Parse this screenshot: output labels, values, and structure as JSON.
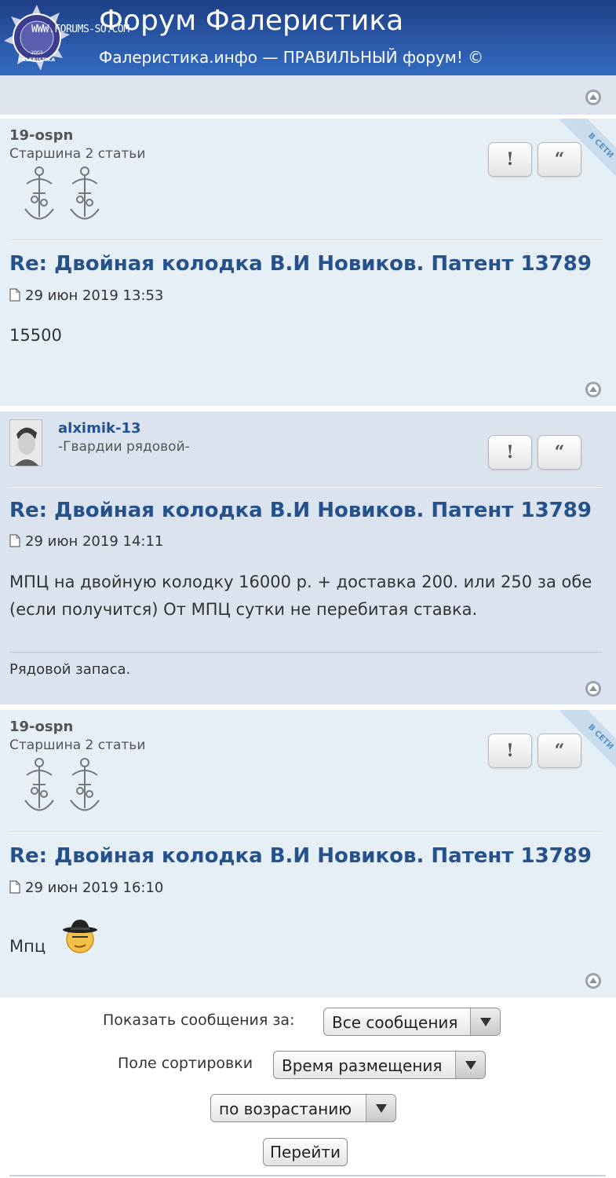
{
  "header": {
    "watermark": "WWW.FORUMS-SO.COM",
    "title": "Форум Фалеристика",
    "description": "Фалеристика.инфо — ПРАВИЛЬНЫЙ форум! ©",
    "logo_texts": {
      "year": "2003",
      "name": "FALERISTIKA"
    },
    "colors": {
      "header_bg": "#2a58a8",
      "link": "#25528c"
    }
  },
  "posts": [
    {
      "author": "19-ospn",
      "rank": "Старшина 2 статьи",
      "online_label": "В СЕТИ",
      "report_button": "!",
      "quote_button": "“",
      "title": "Re: Двойная колодка В.И Новиков. Патент 13789",
      "date": "29 июн 2019 13:53",
      "body": "15500"
    },
    {
      "author": "alximik-13",
      "rank": "-Гвардии рядовой-",
      "report_button": "!",
      "quote_button": "“",
      "title": "Re: Двойная колодка В.И Новиков. Патент 13789",
      "date": "29 июн 2019 14:11",
      "body": "МПЦ на двойную колодку 16000 р. + доставка 200. или 250 за обе (если получится) От МПЦ сутки не перебитая ставка.",
      "signature": "Рядовой запаса."
    },
    {
      "author": "19-ospn",
      "rank": "Старшина 2 статьи",
      "online_label": "В СЕТИ",
      "report_button": "!",
      "quote_button": "“",
      "title": "Re: Двойная колодка В.И Новиков. Патент 13789",
      "date": "29 июн 2019 16:10",
      "body": "Мпц",
      "smiley": "cool-smiley-icon"
    }
  ],
  "controls": {
    "show_label": "Показать сообщения за:",
    "show_value": "Все сообщения",
    "sort_label": "Поле сортировки",
    "sort_value": "Время размещения",
    "order_value": "по возрастанию",
    "go_button": "Перейти"
  }
}
